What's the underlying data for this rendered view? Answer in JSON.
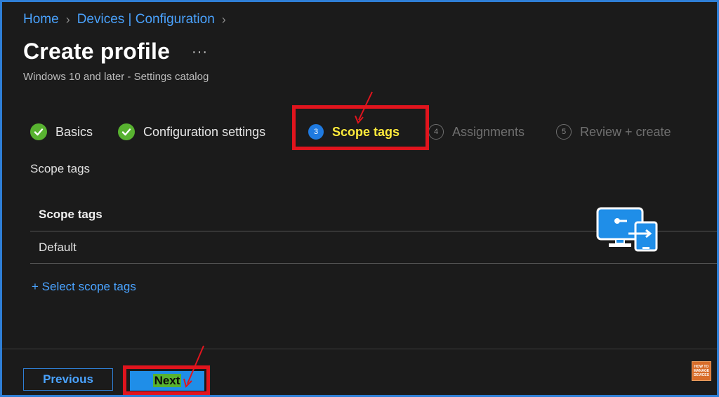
{
  "breadcrumb": {
    "items": [
      "Home",
      "Devices | Configuration"
    ]
  },
  "page": {
    "title": "Create profile",
    "more": "···",
    "subtitle": "Windows 10 and later - Settings catalog"
  },
  "steps": [
    {
      "label": "Basics",
      "state": "done"
    },
    {
      "label": "Configuration settings",
      "state": "done"
    },
    {
      "number": "3",
      "label": "Scope tags",
      "state": "active"
    },
    {
      "number": "4",
      "label": "Assignments",
      "state": "pending"
    },
    {
      "number": "5",
      "label": "Review + create",
      "state": "pending"
    }
  ],
  "scope": {
    "section_label": "Scope tags",
    "table_header": "Scope tags",
    "rows": [
      "Default"
    ],
    "select_link": "+ Select scope tags"
  },
  "footer": {
    "previous_label": "Previous",
    "next_label": "Next"
  },
  "badge": {
    "lines": [
      "HOW TO",
      "MANAGE",
      "DEVICES"
    ]
  },
  "colors": {
    "accent": "#2f7fd6",
    "link": "#4aa3ff",
    "success": "#58b230",
    "highlight": "#e1141d",
    "active_step_text": "#ffeb3b"
  },
  "icons": {
    "check": "check-icon",
    "breadcrumb_separator": "chevron-right-icon",
    "logo": "remote-monitor-icon"
  }
}
